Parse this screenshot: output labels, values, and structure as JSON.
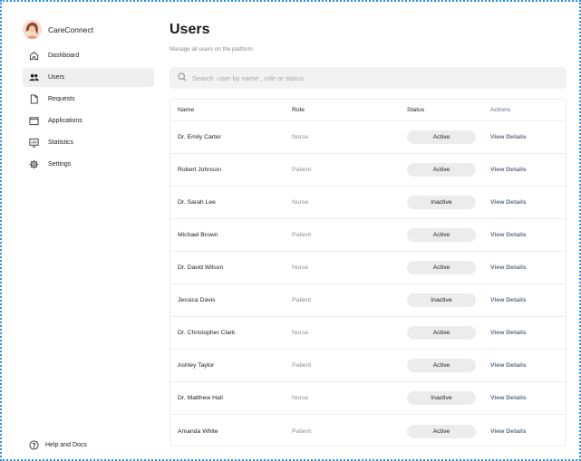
{
  "brand": {
    "name": "CareConnect"
  },
  "sidebar": {
    "items": [
      {
        "label": "Dashboard",
        "icon": "home-icon",
        "active": false
      },
      {
        "label": "Users",
        "icon": "users-icon",
        "active": true
      },
      {
        "label": "Requests",
        "icon": "document-icon",
        "active": false
      },
      {
        "label": "Applications",
        "icon": "folder-icon",
        "active": false
      },
      {
        "label": "Statistics",
        "icon": "chart-icon",
        "active": false
      },
      {
        "label": "Settings",
        "icon": "gear-icon",
        "active": false
      }
    ],
    "help_label": "Help and Docs"
  },
  "page": {
    "title": "Users",
    "subtitle": "Manage all users on the platform"
  },
  "search": {
    "placeholder": "Search  user by name , role or status",
    "value": ""
  },
  "table": {
    "headers": {
      "name": "Name",
      "role": "Role",
      "status": "Status",
      "actions": "Actions"
    },
    "rows": [
      {
        "name": "Dr. Emily Carter",
        "role": "Nurse",
        "status": "Active",
        "action": "View Details"
      },
      {
        "name": "Robert Johnson",
        "role": "Patient",
        "status": "Active",
        "action": "View Details"
      },
      {
        "name": "Dr. Sarah Lee",
        "role": "Nurse",
        "status": "Inactive",
        "action": "View Details"
      },
      {
        "name": "Michael Brown",
        "role": "Patient",
        "status": "Active",
        "action": "View Details"
      },
      {
        "name": "Dr. David Wilson",
        "role": "Nurse",
        "status": "Active",
        "action": "View Details"
      },
      {
        "name": "Jessica Davis",
        "role": "Patient",
        "status": "Inactive",
        "action": "View Details"
      },
      {
        "name": "Dr. Christopher Clark",
        "role": "Nurse",
        "status": "Active",
        "action": "View Details"
      },
      {
        "name": "Ashley Taylor",
        "role": "Patient",
        "status": "Active",
        "action": "View Details"
      },
      {
        "name": "Dr. Matthew Hall",
        "role": "Nurse",
        "status": "Inactive",
        "action": "View Details"
      },
      {
        "name": "Amanda White",
        "role": "Patient",
        "status": "Active",
        "action": "View Details"
      }
    ]
  },
  "colors": {
    "frame_border": "#2e8fe0",
    "active_nav_bg": "#efefef",
    "link": "#5e6e80",
    "pill_bg": "#ececec"
  }
}
